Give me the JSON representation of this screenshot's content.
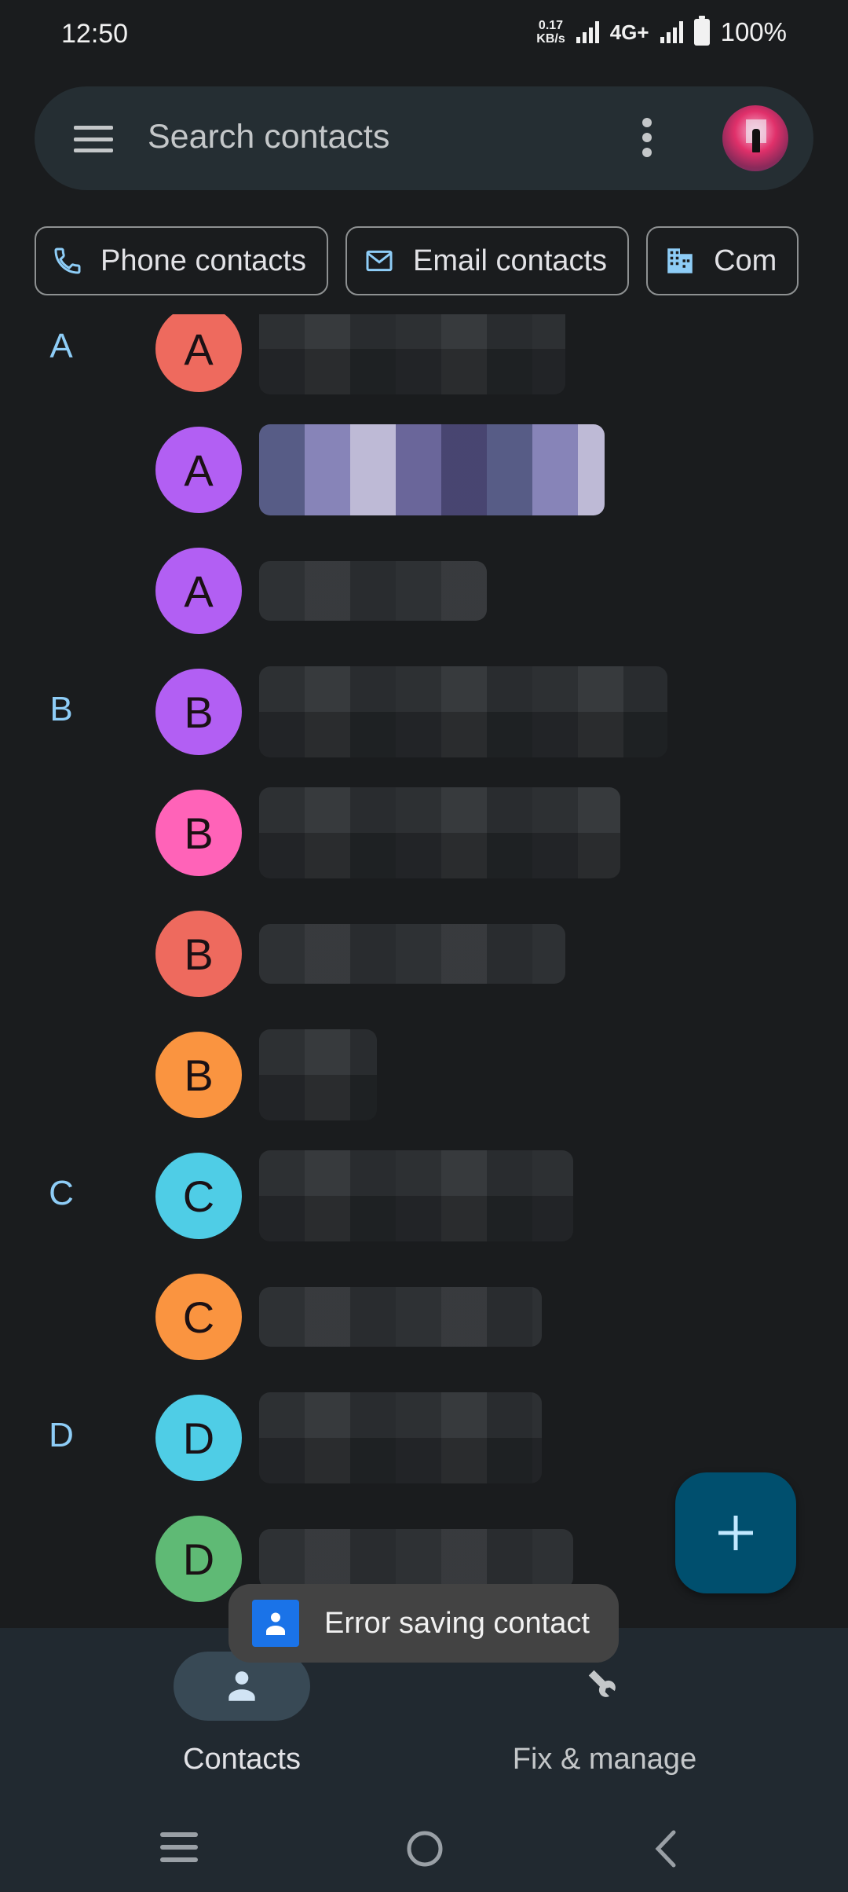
{
  "status_bar": {
    "time": "12:50",
    "net_speed_value": "0.17",
    "net_speed_unit": "KB/s",
    "network_type": "4G+",
    "battery_percent": "100%"
  },
  "search": {
    "placeholder": "Search contacts"
  },
  "filter_chips": [
    {
      "label": "Phone contacts",
      "icon": "phone-icon"
    },
    {
      "label": "Email contacts",
      "icon": "email-icon"
    },
    {
      "label": "Com",
      "icon": "company-icon"
    }
  ],
  "contacts": [
    {
      "section": "A",
      "initial": "A",
      "color": "#ee6a5e",
      "name": "[redacted]"
    },
    {
      "section": "",
      "initial": "A",
      "color": "#b25ff3",
      "name": "[redacted]"
    },
    {
      "section": "",
      "initial": "A",
      "color": "#b25ff3",
      "name": "[redacted]"
    },
    {
      "section": "B",
      "initial": "B",
      "color": "#b25ff3",
      "name": "[redacted]"
    },
    {
      "section": "",
      "initial": "B",
      "color": "#ff63b8",
      "name": "[redacted]"
    },
    {
      "section": "",
      "initial": "B",
      "color": "#ee6a5e",
      "name": "[redacted]"
    },
    {
      "section": "",
      "initial": "B",
      "color": "#fa9440",
      "name": "[redacted]"
    },
    {
      "section": "C",
      "initial": "C",
      "color": "#4fcde6",
      "name": "[redacted]"
    },
    {
      "section": "",
      "initial": "C",
      "color": "#fa9440",
      "name": "[redacted]"
    },
    {
      "section": "D",
      "initial": "D",
      "color": "#4fcde6",
      "name": "[redacted]"
    },
    {
      "section": "",
      "initial": "D",
      "color": "#5fba75",
      "name": "[redacted]"
    },
    {
      "section": "",
      "initial": "",
      "color": "#5fba75",
      "name": "[redacted]"
    }
  ],
  "fab": {
    "label": "Create contact",
    "icon": "plus-icon"
  },
  "toast": {
    "text": "Error saving contact"
  },
  "bottom_nav": {
    "items": [
      {
        "label": "Contacts",
        "icon": "person-icon",
        "selected": true
      },
      {
        "label": "Fix & manage",
        "icon": "wrench-icon",
        "selected": false
      }
    ]
  },
  "system_nav": {
    "recents": "recents-icon",
    "home": "home-icon",
    "back": "back-icon"
  },
  "colors": {
    "background": "#1a1c1e",
    "search_bar": "#252e33",
    "section_letter": "#8ecdf7",
    "fab": "#004f6e",
    "bottom_nav": "#212930",
    "toast": "#434343"
  }
}
